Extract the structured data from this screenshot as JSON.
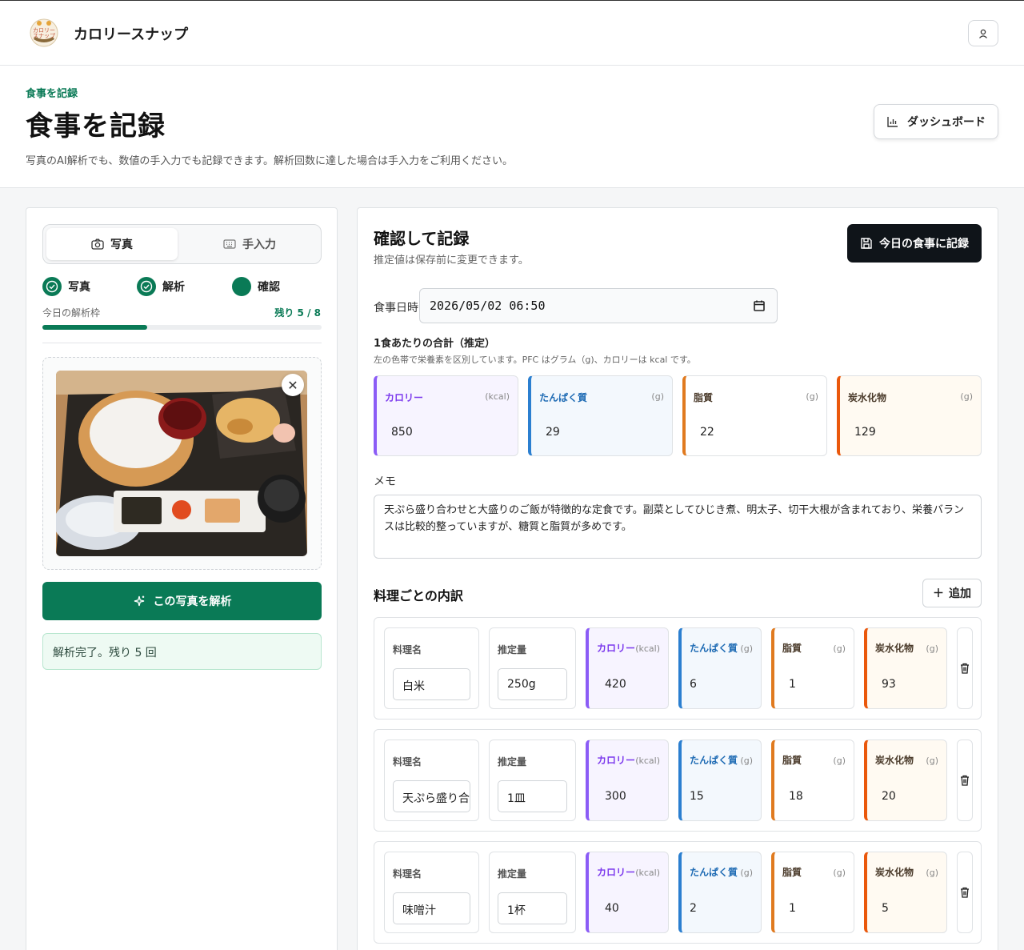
{
  "app": {
    "title": "カロリースナップ",
    "logo_text": "カロリースナップ"
  },
  "page": {
    "breadcrumb": "食事を記録",
    "title": "食事を記録",
    "subtitle": "写真のAI解析でも、数値の手入力でも記録できます。解析回数に達した場合は手入力をご利用ください。",
    "dashboard_label": "ダッシュボード"
  },
  "left": {
    "tabs": [
      {
        "label": "写真",
        "icon": "camera-icon"
      },
      {
        "label": "手入力",
        "icon": "keyboard-icon"
      }
    ],
    "steps": [
      {
        "label": "写真"
      },
      {
        "label": "解析"
      },
      {
        "label": "確認"
      }
    ],
    "quota_label": "今日の解析枠",
    "quota_count": "残り 5 / 8",
    "quota_used_fraction": 0.375,
    "analyze_label": "この写真を解析",
    "status_text": "解析完了。残り 5 回"
  },
  "right": {
    "title": "確認して記録",
    "subtitle": "推定値は保存前に変更できます。",
    "save_label": "今日の食事に記録",
    "datetime_label": "食事日時",
    "datetime_value": "2026/05/02 06:50",
    "totals_title": "1食あたりの合計（推定）",
    "totals_sub": "左の色帯で栄養素を区別しています。PFC はグラム（g)、カロリーは kcal です。",
    "totals": [
      {
        "label": "カロリー",
        "unit": "(kcal)",
        "value": "850"
      },
      {
        "label": "たんぱく質",
        "unit": "(g)",
        "value": "29"
      },
      {
        "label": "脂質",
        "unit": "(g)",
        "value": "22"
      },
      {
        "label": "炭水化物",
        "unit": "(g)",
        "value": "129"
      }
    ],
    "memo_label": "メモ",
    "memo_value": "天ぷら盛り合わせと大盛りのご飯が特徴的な定食です。副菜としてひじき煮、明太子、切干大根が含まれており、栄養バランスは比較的整っていますが、糖質と脂質が多めです。",
    "breakdown_title": "料理ごとの内訳",
    "add_label": "追加",
    "col_labels": {
      "name": "料理名",
      "amount": "推定量",
      "cal": "カロリー",
      "cal_unit": "(kcal)",
      "pro": "たんぱく質",
      "pro_unit": "(g)",
      "fat": "脂質",
      "fat_unit": "(g)",
      "carb": "炭水化物",
      "carb_unit": "(g)"
    },
    "dishes": [
      {
        "name": "白米",
        "amount": "250g",
        "cal": "420",
        "pro": "6",
        "fat": "1",
        "carb": "93"
      },
      {
        "name": "天ぷら盛り合わせ",
        "amount": "1皿",
        "cal": "300",
        "pro": "15",
        "fat": "18",
        "carb": "20"
      },
      {
        "name": "味噌汁",
        "amount": "1杯",
        "cal": "40",
        "pro": "2",
        "fat": "1",
        "carb": "5"
      }
    ]
  }
}
